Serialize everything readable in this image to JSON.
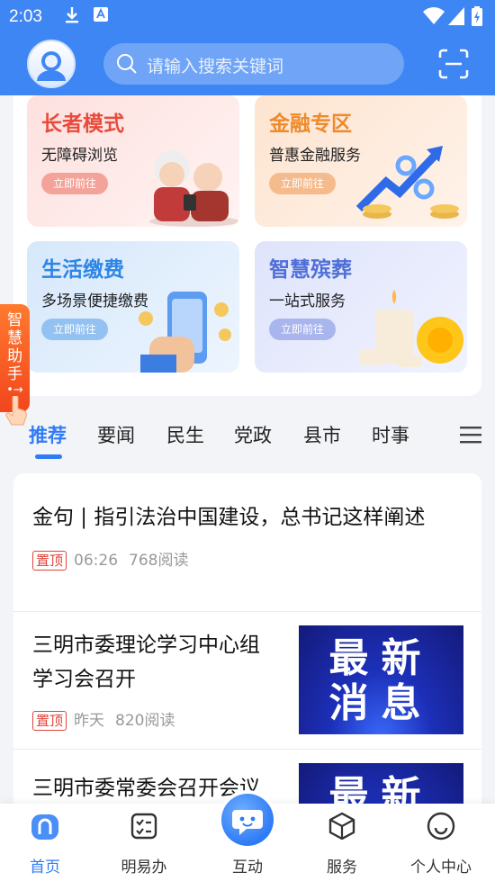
{
  "status_bar": {
    "time": "2:03"
  },
  "search": {
    "placeholder": "请输入搜索关键词"
  },
  "services": [
    {
      "title": "长者模式",
      "subtitle": "无障碍浏览",
      "button": "立即前往",
      "title_color": "#e84b3b",
      "bg": "#fde4e2",
      "button_color": "#f3a39a"
    },
    {
      "title": "金融专区",
      "subtitle": "普惠金融服务",
      "button": "立即前往",
      "title_color": "#ee8a2c",
      "bg": "#fde9d8",
      "button_color": "#f6bb8d"
    },
    {
      "title": "生活缴费",
      "subtitle": "多场景便捷缴费",
      "button": "立即前往",
      "title_color": "#2d86e6",
      "bg": "#dcebfb",
      "button_color": "#93c1f1"
    },
    {
      "title": "智慧殡葬",
      "subtitle": "一站式服务",
      "button": "立即前往",
      "title_color": "#4f6fd8",
      "bg": "#e1e6fb",
      "button_color": "#a9b6ee"
    }
  ],
  "helper": {
    "label": [
      "智",
      "慧",
      "助",
      "手"
    ]
  },
  "tabs": [
    "推荐",
    "要闻",
    "民生",
    "党政",
    "县市",
    "时事"
  ],
  "news": [
    {
      "title": "金句 | 指引法治中国建设，总书记这样阐述",
      "pin": "置顶",
      "time": "06:26",
      "reads": "768阅读"
    },
    {
      "title_lines": [
        "三明市委理论学习中心组",
        "学习会召开"
      ],
      "pin": "置顶",
      "time": "昨天",
      "reads": "820阅读",
      "thumb_text": [
        "最新",
        "消息"
      ]
    },
    {
      "title": "三明市委常委会召开会议",
      "thumb_text": [
        "最新"
      ]
    }
  ],
  "bottom_nav": [
    {
      "label": "首页",
      "icon": "home-icon"
    },
    {
      "label": "明易办",
      "icon": "checklist-icon"
    },
    {
      "label": "互动",
      "icon": "chat-icon"
    },
    {
      "label": "服务",
      "icon": "cube-icon"
    },
    {
      "label": "个人中心",
      "icon": "smile-icon"
    }
  ],
  "colors": {
    "primary": "#3f86f5",
    "active": "#2f7bf5",
    "pin": "#e0433a"
  }
}
